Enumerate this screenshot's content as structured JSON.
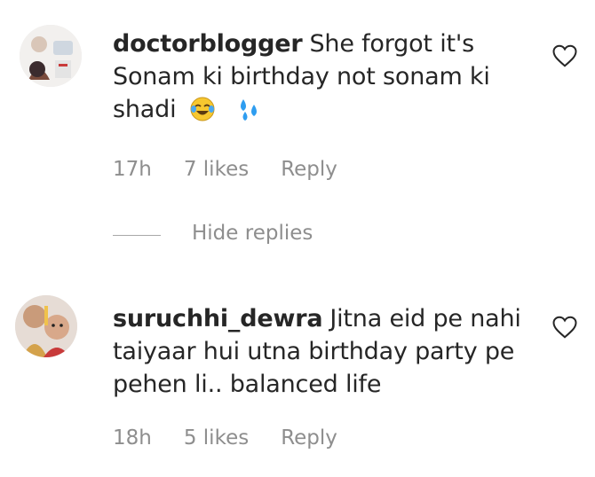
{
  "comments": [
    {
      "username": "doctorblogger",
      "text": "She forgot it's Sonam ki birthday not sonam ki shadi",
      "emojis": [
        "face-with-tears-of-joy-emoji",
        "sweat-droplets-emoji"
      ],
      "time": "17h",
      "likes": "7 likes",
      "reply": "Reply",
      "like_icon": "heart-outline-icon"
    },
    {
      "username": "suruchhi_dewra",
      "text": "Jitna eid pe nahi taiyaar hui utna birthday party pe pehen li.. balanced life",
      "time": "18h",
      "likes": "5 likes",
      "reply": "Reply",
      "like_icon": "heart-outline-icon"
    }
  ],
  "replies_toggle": "Hide replies",
  "colors": {
    "text": "#262626",
    "secondary": "#8e8e8e",
    "emoji_face": "#f7c72f",
    "emoji_drops": "#2e9df0"
  }
}
